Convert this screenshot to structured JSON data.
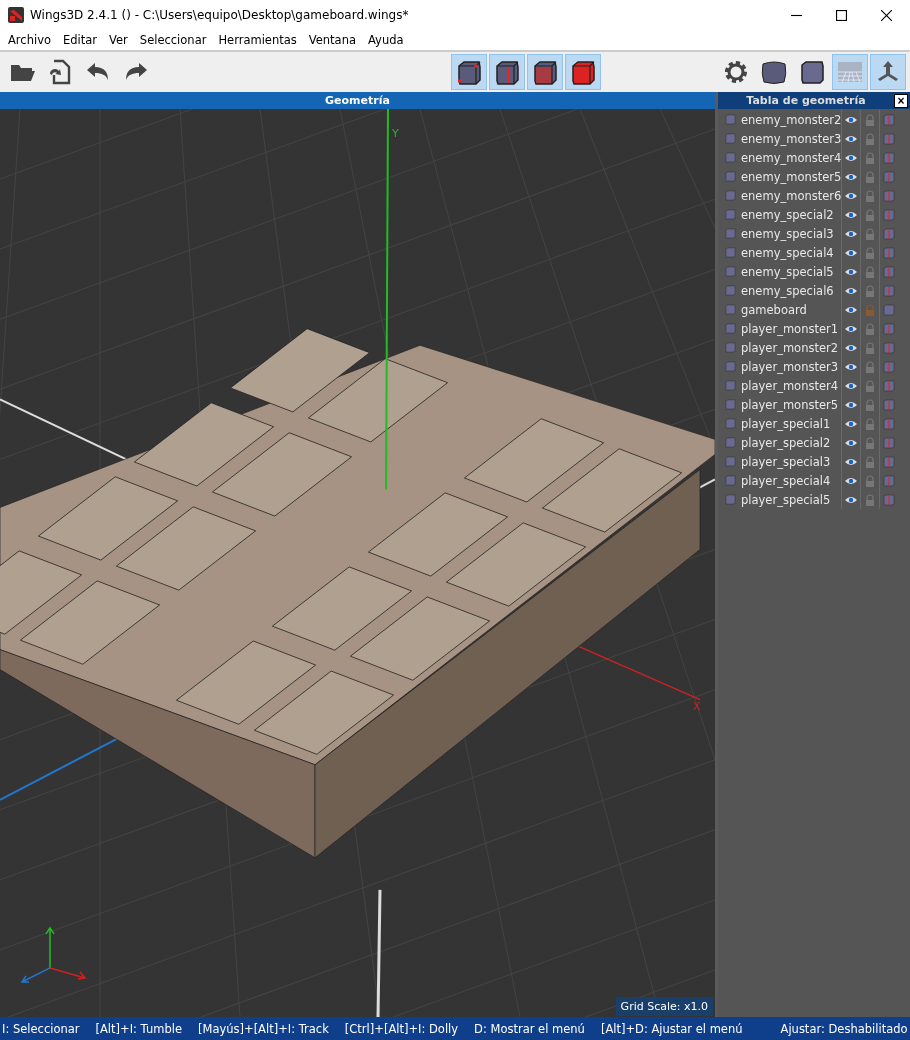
{
  "window": {
    "title": "Wings3D 2.4.1 () - C:\\Users\\equipo\\Desktop\\gameboard.wings*"
  },
  "menu": [
    "Archivo",
    "Editar",
    "Ver",
    "Seleccionar",
    "Herramientas",
    "Ventana",
    "Ayuda"
  ],
  "toolbar": {
    "left": [
      {
        "kind": "open"
      },
      {
        "kind": "import"
      },
      {
        "kind": "undo"
      },
      {
        "kind": "redo"
      }
    ],
    "modes": [
      {
        "kind": "vertex",
        "selected": true
      },
      {
        "kind": "edge",
        "selected": true
      },
      {
        "kind": "face",
        "selected": true
      },
      {
        "kind": "body",
        "selected": true
      }
    ],
    "right": [
      {
        "kind": "gear",
        "on": false
      },
      {
        "kind": "smooth",
        "on": false
      },
      {
        "kind": "flat",
        "on": false
      },
      {
        "kind": "ground",
        "on": true
      },
      {
        "kind": "axes",
        "on": true
      }
    ]
  },
  "viewport": {
    "title": "Geometría",
    "y_label": "Y",
    "x_label": "X",
    "grid_scale": "Grid Scale: x1.0"
  },
  "geometry_table": {
    "title": "Tabla de geometría",
    "close": "×",
    "objects": [
      {
        "name": "enemy_monster2",
        "visible": true,
        "locked": false
      },
      {
        "name": "enemy_monster3",
        "visible": true,
        "locked": false
      },
      {
        "name": "enemy_monster4",
        "visible": true,
        "locked": false
      },
      {
        "name": "enemy_monster5",
        "visible": true,
        "locked": false
      },
      {
        "name": "enemy_monster6",
        "visible": true,
        "locked": false
      },
      {
        "name": "enemy_special2",
        "visible": true,
        "locked": false
      },
      {
        "name": "enemy_special3",
        "visible": true,
        "locked": false
      },
      {
        "name": "enemy_special4",
        "visible": true,
        "locked": false
      },
      {
        "name": "enemy_special5",
        "visible": true,
        "locked": false
      },
      {
        "name": "enemy_special6",
        "visible": true,
        "locked": false
      },
      {
        "name": "gameboard",
        "visible": true,
        "locked": true
      },
      {
        "name": "player_monster1",
        "visible": true,
        "locked": false
      },
      {
        "name": "player_monster2",
        "visible": true,
        "locked": false
      },
      {
        "name": "player_monster3",
        "visible": true,
        "locked": false
      },
      {
        "name": "player_monster4",
        "visible": true,
        "locked": false
      },
      {
        "name": "player_monster5",
        "visible": true,
        "locked": false
      },
      {
        "name": "player_special1",
        "visible": true,
        "locked": false
      },
      {
        "name": "player_special2",
        "visible": true,
        "locked": false
      },
      {
        "name": "player_special3",
        "visible": true,
        "locked": false
      },
      {
        "name": "player_special4",
        "visible": true,
        "locked": false
      },
      {
        "name": "player_special5",
        "visible": true,
        "locked": false
      }
    ]
  },
  "status_bar": [
    "I: Seleccionar",
    "[Alt]+I: Tumble",
    "[Mayús]+[Alt]+I: Track",
    "[Ctrl]+[Alt]+I: Dolly",
    "D: Mostrar el menú",
    "[Alt]+D: Ajustar el menú",
    "Ajustar: Deshabilitado"
  ]
}
